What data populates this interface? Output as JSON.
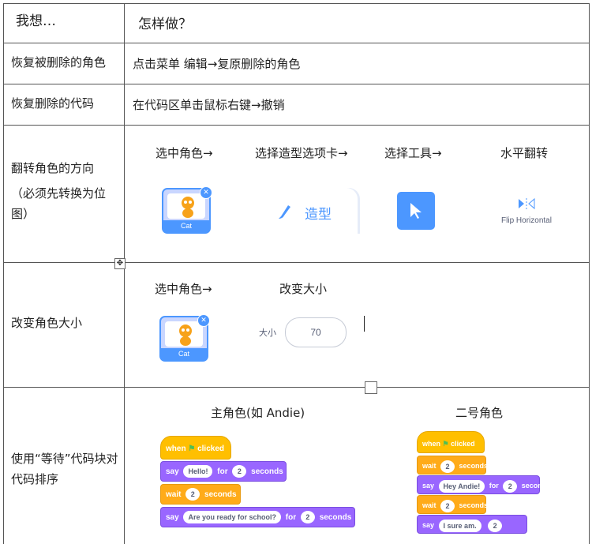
{
  "header": {
    "col1": "我想…",
    "col2": "怎样做？"
  },
  "rows": [
    {
      "want": "恢复被删除的角色",
      "how": "点击菜单 编辑→复原删除的角色"
    },
    {
      "want": "恢复删除的代码",
      "how": "在代码区单击鼠标右键→撤销"
    },
    {
      "want": "翻转角色的方向",
      "want_note": "（必须先转换为位图）",
      "steps": [
        "选中角色→",
        "选择造型选项卡→",
        "选择工具→",
        "水平翻转"
      ],
      "sprite_caption": "Cat",
      "costume_tab": "造型",
      "flip_label": "Flip Horizontal"
    },
    {
      "want": "改变角色大小",
      "steps": [
        "选中角色→",
        "改变大小"
      ],
      "sprite_caption": "Cat",
      "size_label": "大小",
      "size_value": "70"
    },
    {
      "want": "使用“等待”代码块对代码排序",
      "main_title": "主角色(如 Andie)",
      "second_title": "二号角色",
      "main_blocks": {
        "when": "when",
        "clicked": "clicked",
        "say": "say",
        "hello": "Hello!",
        "for": "for",
        "two": "2",
        "seconds": "seconds",
        "wait": "wait",
        "question": "Are you ready for school?"
      },
      "second_blocks": {
        "hey": "Hey Andie!",
        "sure": "I sure am."
      }
    }
  ],
  "colors": {
    "scratch_blue": "#4c97ff",
    "events": "#ffbf00",
    "looks": "#9966ff",
    "control": "#ffab19"
  }
}
